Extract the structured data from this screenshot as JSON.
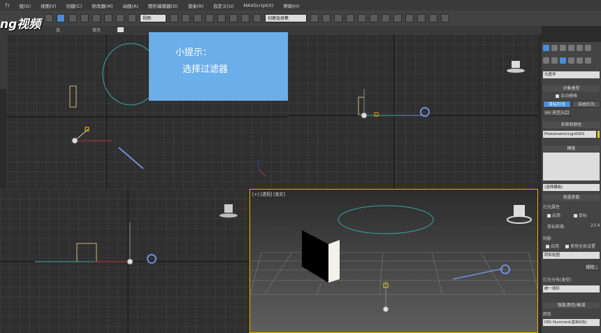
{
  "menu": {
    "items": [
      "T)",
      "组(G)",
      "视图(V)",
      "创建(C)",
      "修改器(M)",
      "动画(A)",
      "图形编辑器(D)",
      "渲染(R)",
      "自定义(U)",
      "MAXScript(X)",
      "帮助(H)"
    ]
  },
  "toolbar": {
    "view_select": "视图",
    "selection_set": "创建选择集"
  },
  "subbar": {
    "item1": "选",
    "item2": "填充"
  },
  "logo": {
    "text": "ng视频"
  },
  "tip": {
    "title": "小提示：",
    "body": "选择过滤器"
  },
  "viewports": {
    "perspective_label": "[+] [透视] [真实]"
  },
  "command_panel": {
    "category_field": "光度学",
    "object_type_header": "对象类型",
    "auto_grid": "自动栅格",
    "target_light": "目标灯光",
    "free_light": "自由灯光",
    "mr_sky_portal": "mr 天空入口",
    "name_color_header": "名称和颜色",
    "object_name": "PhotometricLight001",
    "template_header": "模板",
    "template_select": "(选择模板)",
    "general_params_header": "常规参数",
    "light_props_label": "灯光属性",
    "enable_label": "启用",
    "target_label": "目标",
    "target_distance_label": "目标距离:",
    "target_distance_value": "23.4",
    "shadows_label": "阴影",
    "shadow_enable_label": "启用",
    "global_settings_label": "使用全局设置",
    "shadow_type": "阴影贴图",
    "exclude_button": "排除...",
    "distribution_label": "灯光分布(类型)",
    "distribution_value": "统一球形",
    "intensity_header": "强度/颜色/衰减",
    "color_label": "颜色",
    "color_value": "D65 Illuminant(基准白色)"
  },
  "colors": {
    "tip_bg": "#6aaeea",
    "active_border": "#e8b100",
    "accent_blue": "#4a8fd6"
  }
}
